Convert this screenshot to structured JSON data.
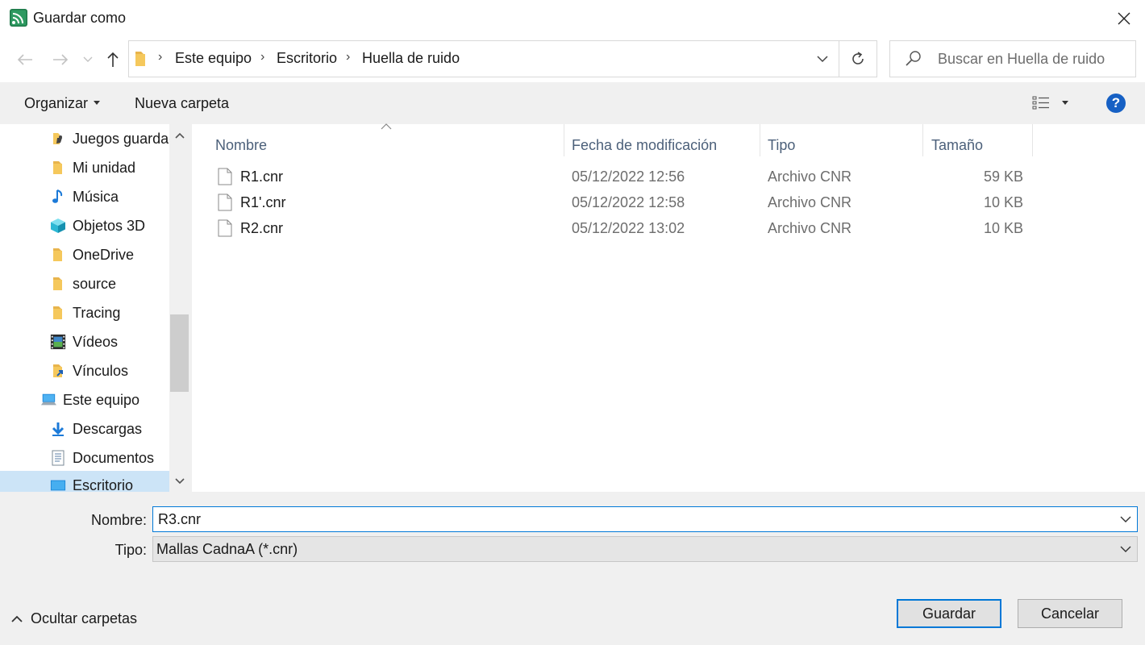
{
  "window": {
    "title": "Guardar como",
    "app_icon": "rss-signal-icon",
    "close_icon": "close-icon"
  },
  "nav": {
    "back_icon": "arrow-left-icon",
    "forward_icon": "arrow-right-icon",
    "recent_icon": "chevron-down-icon",
    "up_icon": "arrow-up-icon",
    "breadcrumb": [
      "Este equipo",
      "Escritorio",
      "Huella de ruido"
    ],
    "refresh_icon": "refresh-icon",
    "search_placeholder": "Buscar en Huella de ruido"
  },
  "toolbar": {
    "organize_label": "Organizar",
    "new_folder_label": "Nueva carpeta",
    "view_icon": "details-view-icon",
    "help_label": "?"
  },
  "sidebar": {
    "items": [
      {
        "label": "Juegos guardados",
        "icon": "saved-games-icon"
      },
      {
        "label": "Mi unidad",
        "icon": "folder-icon"
      },
      {
        "label": "Música",
        "icon": "music-icon"
      },
      {
        "label": "Objetos 3D",
        "icon": "cube-3d-icon"
      },
      {
        "label": "OneDrive",
        "icon": "folder-icon"
      },
      {
        "label": "source",
        "icon": "folder-icon"
      },
      {
        "label": "Tracing",
        "icon": "folder-icon"
      },
      {
        "label": "Vídeos",
        "icon": "video-icon"
      },
      {
        "label": "Vínculos",
        "icon": "links-folder-icon"
      },
      {
        "label": "Este equipo",
        "icon": "computer-icon"
      },
      {
        "label": "Descargas",
        "icon": "download-icon"
      },
      {
        "label": "Documentos",
        "icon": "documents-icon"
      },
      {
        "label": "Escritorio",
        "icon": "desktop-icon",
        "selected": true
      }
    ]
  },
  "file_list": {
    "columns": [
      "Nombre",
      "Fecha de modificación",
      "Tipo",
      "Tamaño"
    ],
    "rows": [
      {
        "name": "R1.cnr",
        "date": "05/12/2022 12:56",
        "type": "Archivo CNR",
        "size": "59 KB"
      },
      {
        "name": "R1'.cnr",
        "date": "05/12/2022 12:58",
        "type": "Archivo CNR",
        "size": "10 KB"
      },
      {
        "name": "R2.cnr",
        "date": "05/12/2022 13:02",
        "type": "Archivo CNR",
        "size": "10 KB"
      }
    ]
  },
  "form": {
    "name_label": "Nombre:",
    "name_value": "R3.cnr",
    "type_label": "Tipo:",
    "type_value": "Mallas CadnaA (*.cnr)"
  },
  "footer": {
    "hide_folders_label": "Ocultar carpetas",
    "save_label": "Guardar",
    "cancel_label": "Cancelar"
  },
  "colors": {
    "accent": "#0078d7",
    "selection": "#cce4f7",
    "folder": "#f5c85c",
    "help": "#1660c4"
  }
}
